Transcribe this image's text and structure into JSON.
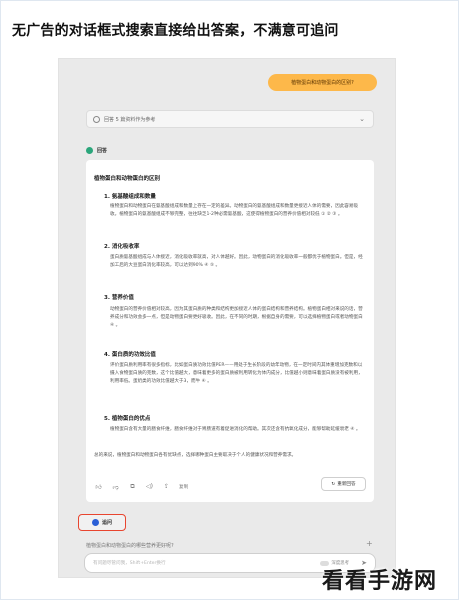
{
  "headline": "无广告的对话框式搜索直接给出答案，不满意可追问",
  "user_question": "植物蛋白和动物蛋白的区别?",
  "search_status": "回答 5 篇资料作为参考",
  "answer_label": "回答",
  "answer": {
    "title": "植物蛋白和动物蛋白的区别",
    "sections": [
      {
        "heading": "1. 氨基酸组成和数量",
        "text": "植物蛋白和动物蛋白在氨基酸组成和数量上存在一定的差异。动物蛋白的氨基酸组成和数量更接近人体的需要，因此容易吸收。植物蛋白的氨基酸组成不够完整，往往缺乏1-2种必需氨基酸，这使得植物蛋白的营养价值相对较低 ① ② ③ 。"
      },
      {
        "heading": "2. 消化吸收率",
        "text": "蛋白质氨基酸组成与人体接近，消化吸收率就高，对人体越好。因此，动物蛋白的消化吸收率一般都优于植物蛋白。但是，经加工后的大豆蛋白消化率较高，可以达到90% ④ ⑤ 。"
      },
      {
        "heading": "3. 营养价值",
        "text": "动物蛋白的营养价值相对较高，因为其蛋白质的种类和结构更加接近人体的蛋白结构和营养结构。植物蛋白相对来说的话，营养成分和功效会多一点，但是动物蛋白要更好吸收。因此，在不同的时期，根据自身的需要，可以选择植物蛋白或者动物蛋白 ④ 。"
      },
      {
        "heading": "4. 蛋白质的功效比值",
        "text": "评价蛋白质利用率有很多指标，比如蛋白质功效比值PER——用处于生长阶段的幼年动物，在一定时间内其体重增加克数和以摄入食物蛋白质的克数，这个比值越大，意味着更多的蛋白质被利用转化为体内成分，比值越小则意味着蛋白质没有被利用，利用率低。蛋奶类的功效比值越大于3，而牛 ④ 。"
      },
      {
        "heading": "5. 植物蛋白的优点",
        "text": "植物蛋白含有大量的膳食纤维，膳食纤维对于胃肠道有着促进消化的帮助。其次还含有抗氧化成分，能够帮助延缓衰老 ④ 。"
      }
    ],
    "conclusion": "总的来说，植物蛋白和动物蛋白各有优缺点，选择哪种蛋白主要取决于个人的健康状况和营养需求。",
    "share_label": "复制",
    "regenerate_label": "重新回答"
  },
  "followup_label": "追问",
  "followup_suggestion": "植物蛋白和动物蛋白的哪些营养更好呢?",
  "input": {
    "placeholder": "有问题尽管问我，Shift+Enter换行",
    "deep_think_label": "深度思考"
  },
  "watermark": "看看手游网",
  "colors": {
    "user_bubble": "#fdb84a",
    "answer_dot": "#2ba67b",
    "followup_border": "#e8452f",
    "followup_dot": "#2a5fd6"
  }
}
